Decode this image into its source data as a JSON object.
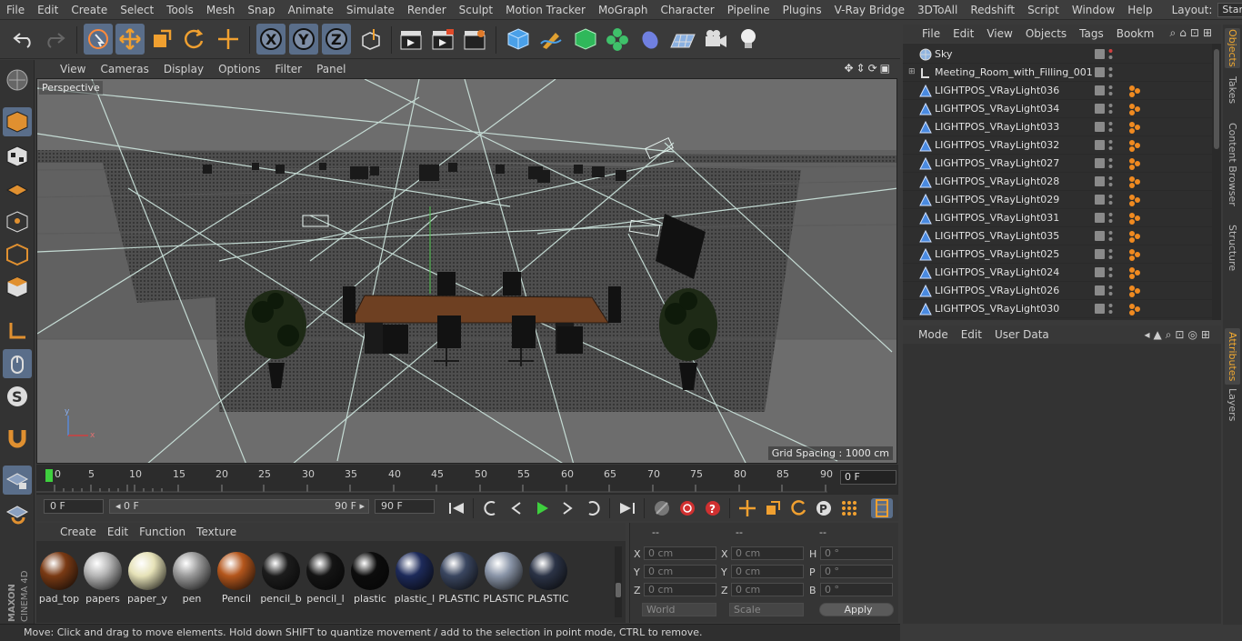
{
  "menubar": {
    "items": [
      "File",
      "Edit",
      "Create",
      "Select",
      "Tools",
      "Mesh",
      "Snap",
      "Animate",
      "Simulate",
      "Render",
      "Sculpt",
      "Motion Tracker",
      "MoGraph",
      "Character",
      "Pipeline",
      "Plugins",
      "V-Ray Bridge",
      "3DToAll",
      "Redshift",
      "Script",
      "Window",
      "Help"
    ],
    "layout_label": "Layout:",
    "layout_value": "Startup"
  },
  "viewport": {
    "menu": [
      "View",
      "Cameras",
      "Display",
      "Options",
      "Filter",
      "Panel"
    ],
    "label": "Perspective",
    "grid_spacing": "Grid Spacing : 1000 cm"
  },
  "timeline": {
    "ticks": [
      "0",
      "5",
      "10",
      "15",
      "20",
      "25",
      "30",
      "35",
      "40",
      "45",
      "50",
      "55",
      "60",
      "65",
      "70",
      "75",
      "80",
      "85",
      "90"
    ],
    "current_frame": "0 F"
  },
  "playbar": {
    "start": "0 F",
    "range_start": "◂ 0 F",
    "range_end": "90 F ▸",
    "end": "90 F"
  },
  "materials": {
    "menu": [
      "Create",
      "Edit",
      "Function",
      "Texture"
    ],
    "items": [
      {
        "label": "pad_top",
        "color": "#7a3a14"
      },
      {
        "label": "papers",
        "color": "#b5b5b5"
      },
      {
        "label": "paper_y",
        "color": "#e6e2b8"
      },
      {
        "label": "pen",
        "color": "#9a9a9a"
      },
      {
        "label": "Pencil",
        "color": "#b4561c"
      },
      {
        "label": "pencil_b",
        "color": "#1c1c1c"
      },
      {
        "label": "pencil_l",
        "color": "#141414"
      },
      {
        "label": "plastic",
        "color": "#0c0c0c"
      },
      {
        "label": "plastic_l",
        "color": "#1d2a5a"
      },
      {
        "label": "PLASTIC",
        "color": "#3a4660"
      },
      {
        "label": "PLASTIC",
        "color": "#8a95a8"
      },
      {
        "label": "PLASTIC",
        "color": "#2b3346"
      }
    ]
  },
  "coords": {
    "headers": [
      "--",
      "--",
      "--"
    ],
    "rows": [
      {
        "a": "X",
        "av": "0 cm",
        "b": "X",
        "bv": "0 cm",
        "c": "H",
        "cv": "0 °"
      },
      {
        "a": "Y",
        "av": "0 cm",
        "b": "Y",
        "bv": "0 cm",
        "c": "P",
        "cv": "0 °"
      },
      {
        "a": "Z",
        "av": "0 cm",
        "b": "Z",
        "bv": "0 cm",
        "c": "B",
        "cv": "0 °"
      }
    ],
    "world": "World",
    "scale": "Scale",
    "apply": "Apply"
  },
  "status": "Move: Click and drag to move elements. Hold down SHIFT to quantize movement / add to the selection in point mode, CTRL to remove.",
  "objects": {
    "menu": [
      "File",
      "Edit",
      "View",
      "Objects",
      "Tags",
      "Bookm"
    ],
    "rows": [
      {
        "name": "Sky",
        "type": "sky"
      },
      {
        "name": "Meeting_Room_with_Filling_001",
        "type": "null"
      },
      {
        "name": "LIGHTPOS_VRayLight036",
        "type": "light"
      },
      {
        "name": "LIGHTPOS_VRayLight034",
        "type": "light"
      },
      {
        "name": "LIGHTPOS_VRayLight033",
        "type": "light"
      },
      {
        "name": "LIGHTPOS_VRayLight032",
        "type": "light"
      },
      {
        "name": "LIGHTPOS_VRayLight027",
        "type": "light"
      },
      {
        "name": "LIGHTPOS_VRayLight028",
        "type": "light"
      },
      {
        "name": "LIGHTPOS_VRayLight029",
        "type": "light"
      },
      {
        "name": "LIGHTPOS_VRayLight031",
        "type": "light"
      },
      {
        "name": "LIGHTPOS_VRayLight035",
        "type": "light"
      },
      {
        "name": "LIGHTPOS_VRayLight025",
        "type": "light"
      },
      {
        "name": "LIGHTPOS_VRayLight024",
        "type": "light"
      },
      {
        "name": "LIGHTPOS_VRayLight026",
        "type": "light"
      },
      {
        "name": "LIGHTPOS_VRayLight030",
        "type": "light"
      }
    ]
  },
  "attributes": {
    "menu": [
      "Mode",
      "Edit",
      "User Data"
    ]
  },
  "sidetabs": {
    "top": [
      "Objects",
      "Takes",
      "Content Browser",
      "Structure"
    ],
    "bottom": [
      "Attributes",
      "Layers"
    ]
  },
  "colors": {
    "accent_tab": "#f0a830",
    "active_button": "#5a6e8a",
    "play_green": "#3ecf3e"
  },
  "logo_text": "MAXON CINEMA 4D"
}
